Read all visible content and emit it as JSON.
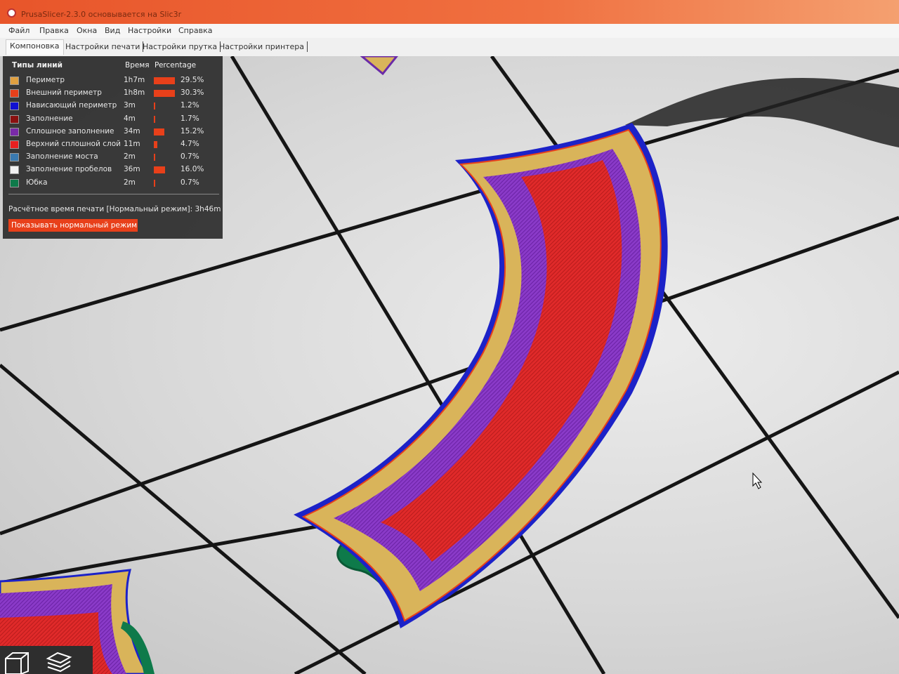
{
  "window": {
    "title": "PrusaSlicer-2.3.0 основывается на Slic3r",
    "accent_color": "#e8552a"
  },
  "menu": [
    "Файл",
    "Правка",
    "Окна",
    "Вид",
    "Настройки",
    "Справка"
  ],
  "tabs": [
    "Компоновка",
    "Настройки печати",
    "Настройки прутка",
    "Настройки принтера"
  ],
  "legend": {
    "header": {
      "type": "Типы линий",
      "time": "Время",
      "percentage": "Percentage"
    },
    "rows": [
      {
        "name": "Периметр",
        "time": "1h7m",
        "percent": "29.5%",
        "color": "#e0a040",
        "fraction": 0.295
      },
      {
        "name": "Внешний периметр",
        "time": "1h8m",
        "percent": "30.3%",
        "color": "#e8401a",
        "fraction": 0.303
      },
      {
        "name": "Нависающий периметр",
        "time": "3m",
        "percent": "1.2%",
        "color": "#1010d0",
        "fraction": 0.012
      },
      {
        "name": "Заполнение",
        "time": "4m",
        "percent": "1.7%",
        "color": "#8a1010",
        "fraction": 0.017
      },
      {
        "name": "Сплошное заполнение",
        "time": "34m",
        "percent": "15.2%",
        "color": "#7a2aa8",
        "fraction": 0.152
      },
      {
        "name": "Верхний сплошной слой",
        "time": "11m",
        "percent": "4.7%",
        "color": "#e82020",
        "fraction": 0.047
      },
      {
        "name": "Заполнение моста",
        "time": "2m",
        "percent": "0.7%",
        "color": "#3a7ab0",
        "fraction": 0.007
      },
      {
        "name": "Заполнение пробелов",
        "time": "36m",
        "percent": "16.0%",
        "color": "#f2f2f2",
        "fraction": 0.16
      },
      {
        "name": "Юбка",
        "time": "2m",
        "percent": "0.7%",
        "color": "#0e7a4a",
        "fraction": 0.007
      }
    ],
    "estimate_label": "Расчётное время печати [Нормальный режим]:",
    "estimate_value": "3h46m",
    "toggle_button": "Показывать нормальный режим"
  },
  "view_buttons": [
    "3d-view-icon",
    "layers-view-icon"
  ]
}
